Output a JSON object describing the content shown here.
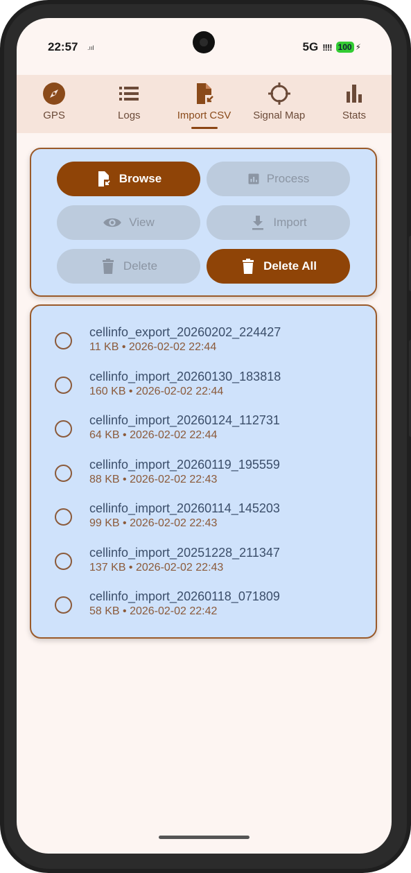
{
  "status_bar": {
    "time": "22:57",
    "network": "5G",
    "signal": "!!!!",
    "battery": "100",
    "mini_icon": ".ııl"
  },
  "tabs": [
    {
      "label": "GPS",
      "icon": "compass-icon",
      "active": false
    },
    {
      "label": "Logs",
      "icon": "list-icon",
      "active": false
    },
    {
      "label": "Import CSV",
      "icon": "file-import-icon",
      "active": true
    },
    {
      "label": "Signal Map",
      "icon": "crosshair-icon",
      "active": false
    },
    {
      "label": "Stats",
      "icon": "bar-chart-icon",
      "active": false
    }
  ],
  "actions": {
    "browse": "Browse",
    "process": "Process",
    "view": "View",
    "import": "Import",
    "delete": "Delete",
    "delete_all": "Delete All"
  },
  "files": [
    {
      "name": "cellinfo_export_20260202_224427",
      "meta": "11 KB • 2026-02-02 22:44"
    },
    {
      "name": "cellinfo_import_20260130_183818",
      "meta": "160 KB • 2026-02-02 22:44"
    },
    {
      "name": "cellinfo_import_20260124_112731",
      "meta": "64 KB • 2026-02-02 22:44"
    },
    {
      "name": "cellinfo_import_20260119_195559",
      "meta": "88 KB • 2026-02-02 22:43"
    },
    {
      "name": "cellinfo_import_20260114_145203",
      "meta": "99 KB • 2026-02-02 22:43"
    },
    {
      "name": "cellinfo_import_20251228_211347",
      "meta": "137 KB • 2026-02-02 22:43"
    },
    {
      "name": "cellinfo_import_20260118_071809",
      "meta": "58 KB • 2026-02-02 22:42"
    }
  ],
  "colors": {
    "primary": "#8f4407",
    "card_bg": "#cfe2fb",
    "card_border": "#9a5a2a",
    "tab_bg": "#f6e4db",
    "screen_bg": "#fdf5f2",
    "disabled_btn": "#bccbdd"
  }
}
